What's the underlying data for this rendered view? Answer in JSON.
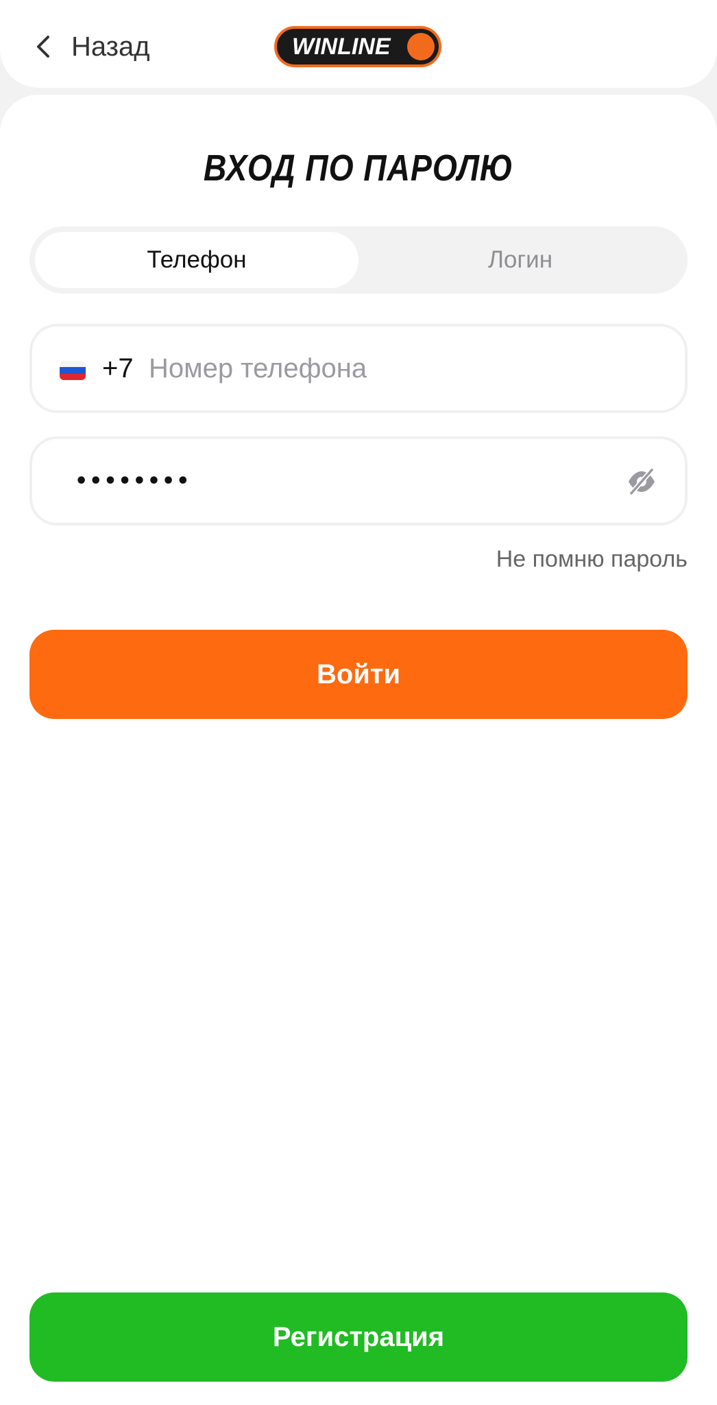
{
  "header": {
    "back_label": "Назад",
    "logo_text": "WINLINE"
  },
  "title": "ВХОД ПО ПАРОЛЮ",
  "tabs": [
    {
      "label": "Телефон",
      "active": true
    },
    {
      "label": "Логин",
      "active": false
    }
  ],
  "phone": {
    "country_prefix": "+7",
    "value": "",
    "placeholder": "Номер телефона",
    "flag_icon": "russia-flag-icon"
  },
  "password": {
    "value": "••••••••",
    "visibility_icon": "eye-off-icon"
  },
  "forgot_password": "Не помню пароль",
  "login_button": "Войти",
  "register_button": "Регистрация",
  "colors": {
    "accent": "#fd6a10",
    "register": "#21bb24",
    "logo_bg": "#1a1a1a",
    "placeholder": "#9a9aa0"
  }
}
